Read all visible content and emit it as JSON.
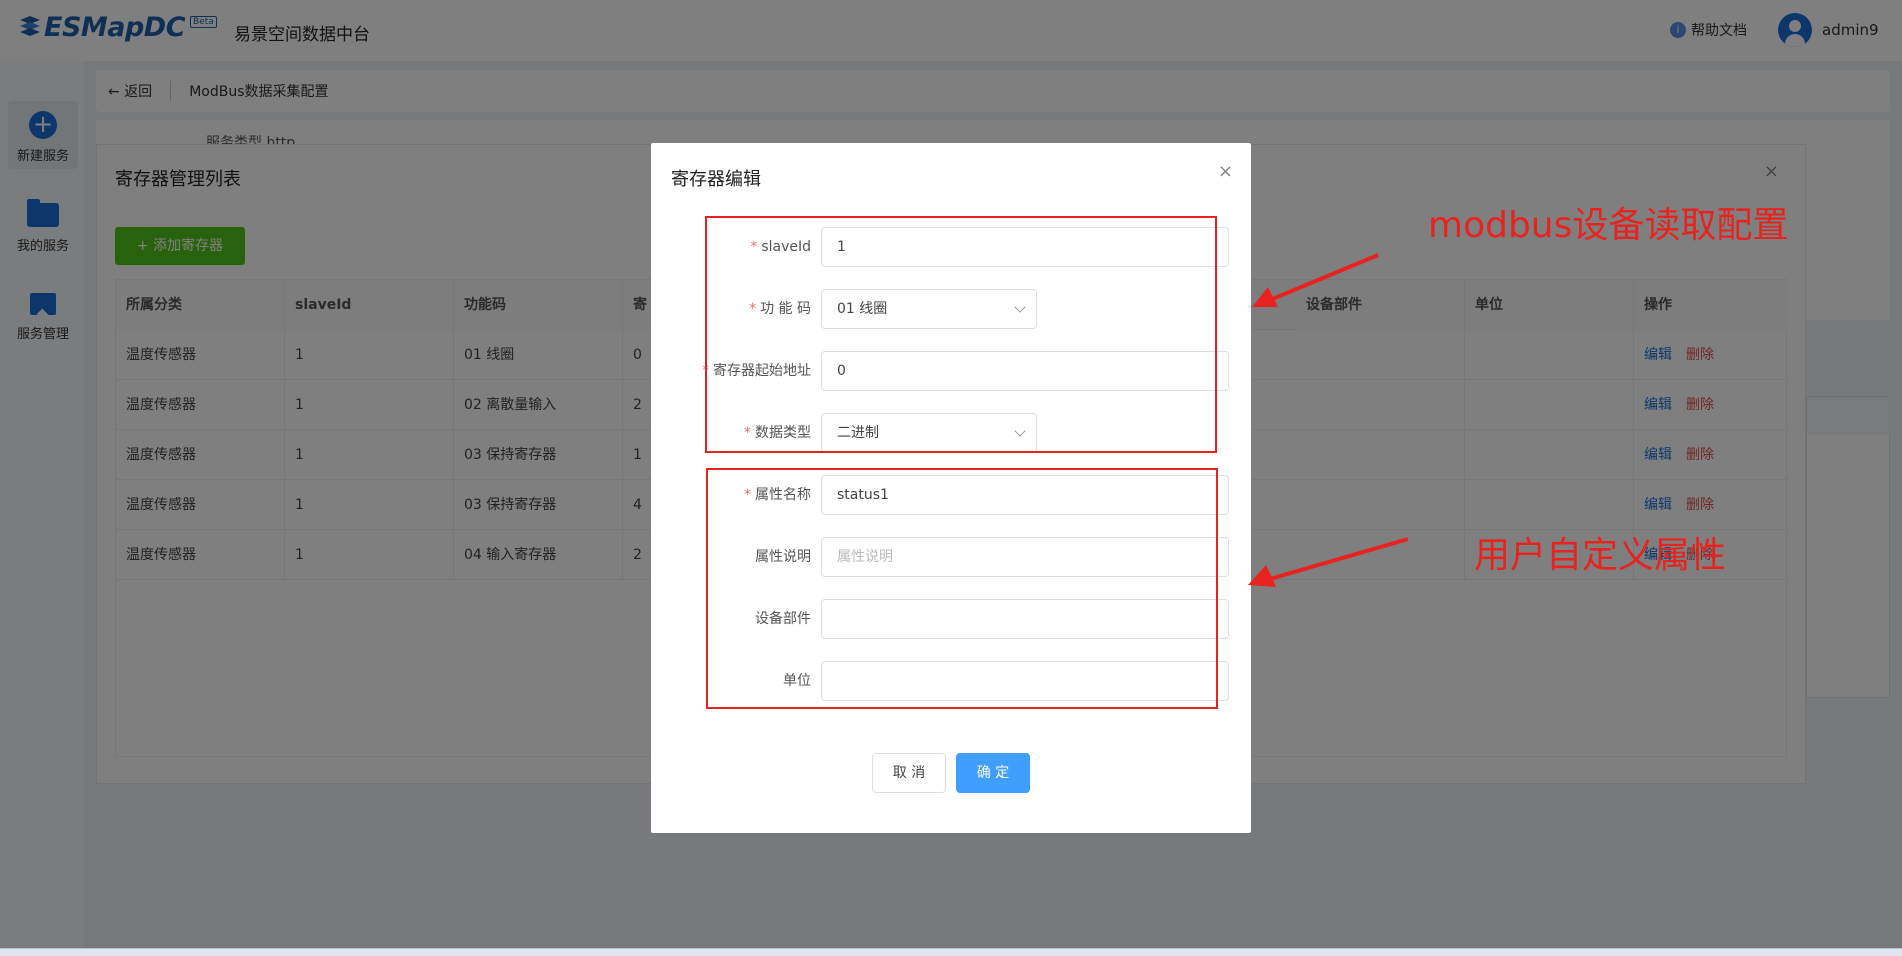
{
  "header": {
    "logo_text": "ESMapDC",
    "logo_beta": "Beta",
    "subtitle": "易景空间数据中台",
    "help_label": "帮助文档",
    "username": "admin9"
  },
  "sidebar": {
    "items": [
      {
        "label": "新建服务",
        "icon": "plus-circle-icon"
      },
      {
        "label": "我的服务",
        "icon": "folder-icon"
      },
      {
        "label": "服务管理",
        "icon": "book-icon"
      }
    ]
  },
  "breadcrumb": {
    "back_label": "返回",
    "title": "ModBus数据采集配置"
  },
  "background_form": {
    "faded_label": "服务类型  http"
  },
  "register_panel": {
    "title": "寄存器管理列表",
    "add_button": "+ 添加寄存器",
    "columns": [
      "所属分类",
      "slaveId",
      "功能码",
      "寄",
      "设备部件",
      "单位",
      "操作"
    ],
    "rows": [
      {
        "category": "温度传感器",
        "slave_id": "1",
        "func_code": "01 线圈",
        "reg": "0"
      },
      {
        "category": "温度传感器",
        "slave_id": "1",
        "func_code": "02 离散量输入",
        "reg": "2"
      },
      {
        "category": "温度传感器",
        "slave_id": "1",
        "func_code": "03 保持寄存器",
        "reg": "1"
      },
      {
        "category": "温度传感器",
        "slave_id": "1",
        "func_code": "03 保持寄存器",
        "reg": "4"
      },
      {
        "category": "温度传感器",
        "slave_id": "1",
        "func_code": "04 输入寄存器",
        "reg": "2"
      }
    ],
    "op_edit": "编辑",
    "op_delete": "删除"
  },
  "dialog": {
    "title": "寄存器编辑",
    "fields": {
      "slave_id": {
        "label": "slaveId",
        "value": "1",
        "required": true
      },
      "func_code": {
        "label": "功 能 码",
        "value": "01 线圈",
        "required": true
      },
      "start_addr": {
        "label": "寄存器起始地址",
        "value": "0",
        "required": true
      },
      "data_type": {
        "label": "数据类型",
        "value": "二进制",
        "required": true
      },
      "attr_name": {
        "label": "属性名称",
        "value": "status1",
        "required": true
      },
      "attr_desc": {
        "label": "属性说明",
        "value": "",
        "placeholder": "属性说明",
        "required": false
      },
      "device_part": {
        "label": "设备部件",
        "value": "",
        "required": false
      },
      "unit": {
        "label": "单位",
        "value": "",
        "required": false
      }
    },
    "cancel_label": "取 消",
    "ok_label": "确 定"
  },
  "annotations": {
    "top": "modbus设备读取配置",
    "bottom": "用户自定义属性"
  },
  "colors": {
    "primary": "#409eff",
    "brand": "#1a6fd6",
    "success": "#52c41a",
    "danger": "#e34d4d",
    "annotation_red": "#e8231f"
  }
}
